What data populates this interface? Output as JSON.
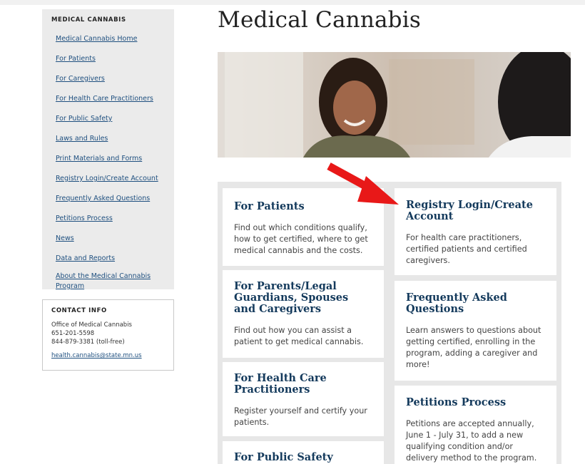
{
  "sidebar": {
    "title": "MEDICAL CANNABIS",
    "links": [
      "Medical Cannabis Home",
      "For Patients",
      "For Caregivers",
      "For Health Care Practitioners",
      "For Public Safety",
      "Laws and Rules",
      "Print Materials and Forms",
      "Registry Login/Create Account",
      "Frequently Asked Questions",
      "Petitions Process",
      "News",
      "Data and Reports",
      "About the Medical Cannabis Program"
    ]
  },
  "contact": {
    "title": "CONTACT INFO",
    "org": "Office of Medical Cannabis",
    "phone": "651-201-5598",
    "tollfree": "844-879-3381 (toll-free)",
    "email": "health.cannabis@state.mn.us"
  },
  "page": {
    "title": "Medical Cannabis"
  },
  "cards": {
    "patients": {
      "title": "For Patients",
      "text": "Find out which conditions qualify, how to get certified, where to get medical cannabis and the costs."
    },
    "registry": {
      "title": "Registry Login/Create Account",
      "text": "For health care practitioners, certified patients and certified caregivers."
    },
    "parents": {
      "title": "For Parents/Legal Guardians, Spouses and Caregivers",
      "text": "Find out how you can assist a patient to get medical cannabis."
    },
    "faq": {
      "title": "Frequently Asked Questions",
      "text": "Learn answers to questions about getting certified, enrolling in the program, adding a caregiver and more!"
    },
    "practitioners": {
      "title": "For Health Care Practitioners",
      "text": "Register yourself and certify your patients."
    },
    "petitions": {
      "title": "Petitions Process",
      "text": "Petitions are accepted annually, June 1 - July 31, to add a new qualifying condition and/or delivery method to the program."
    },
    "public_safety": {
      "title": "For Public Safety",
      "text": ""
    }
  },
  "colors": {
    "link": "#1e4f7f",
    "card_title": "#143a5c",
    "arrow": "#e81818",
    "panel": "#e7e7e7"
  }
}
